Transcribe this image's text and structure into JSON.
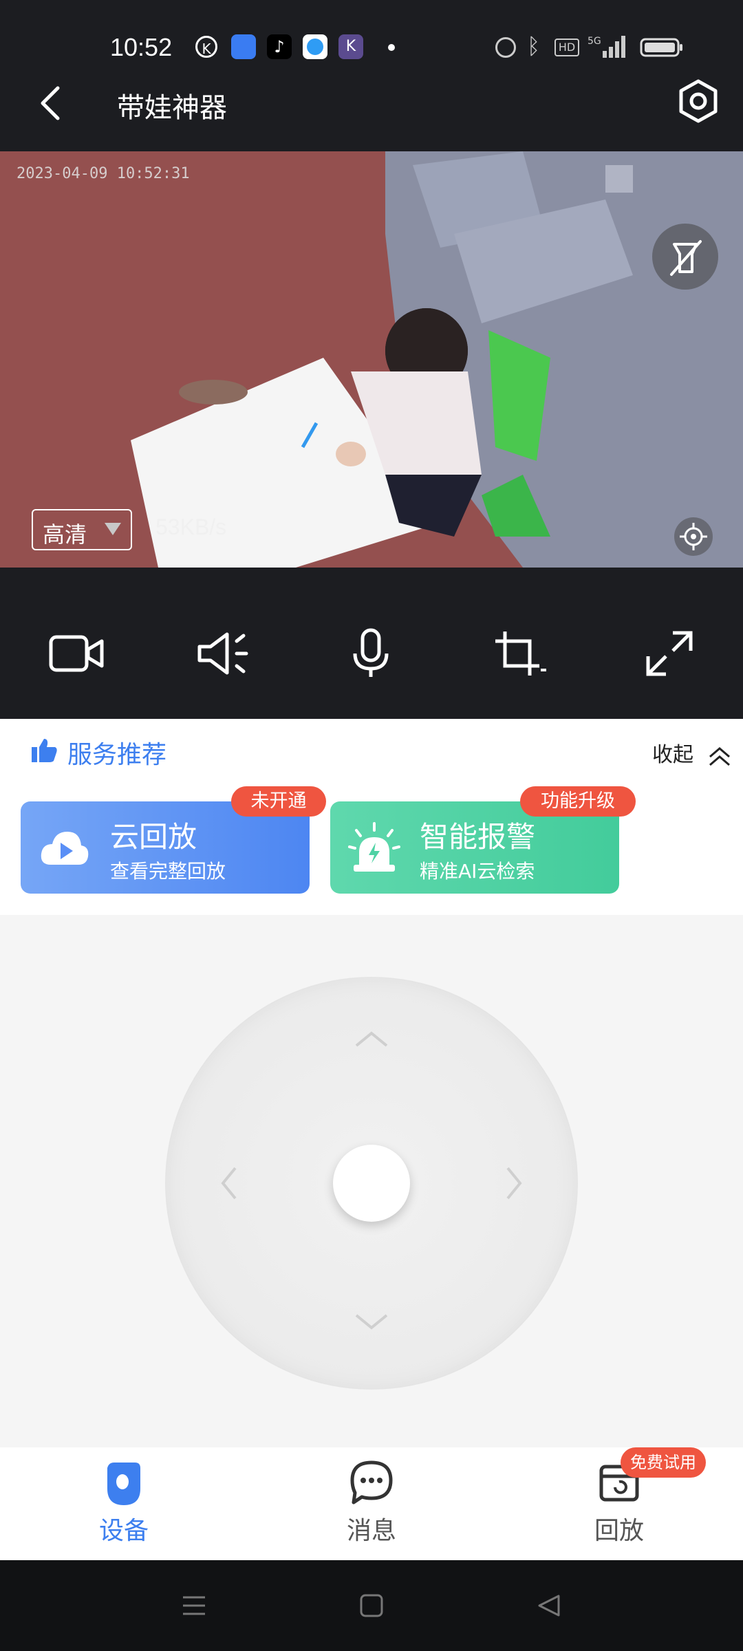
{
  "status_bar": {
    "time": "10:52",
    "app_icons": [
      "k-circle-icon",
      "blue-app-icon",
      "tiktok-icon",
      "browser-icon",
      "k-app-icon",
      "dot-icon"
    ],
    "right_icons": [
      "alarm-icon",
      "bluetooth-icon",
      "hd-icon",
      "5g-signal-icon",
      "battery-icon"
    ]
  },
  "header": {
    "title": "带娃神器",
    "back_icon": "chevron-left-icon",
    "settings_icon": "settings-hex-icon"
  },
  "video": {
    "osd_timestamp": "2023-04-09 10:52:31",
    "quality_label": "高清",
    "speed": "53KB/s",
    "overlay_icons": [
      "flashlight-off-icon",
      "crosshair-icon"
    ]
  },
  "controls": [
    "record-video-icon",
    "speaker-icon",
    "microphone-icon",
    "crop-icon",
    "fullscreen-icon"
  ],
  "service": {
    "title": "服务推荐",
    "collapse_label": "收起",
    "cards": [
      {
        "title": "云回放",
        "subtitle": "查看完整回放",
        "badge": "未开通",
        "icon": "cloud-play-icon",
        "color": "#5a8ff6"
      },
      {
        "title": "智能报警",
        "subtitle": "精准AI云检索",
        "badge": "功能升级",
        "icon": "alarm-light-icon",
        "color": "#4fd2a4"
      }
    ]
  },
  "ptz": {
    "directions": [
      "up-arrow-icon",
      "down-arrow-icon",
      "left-arrow-icon",
      "right-arrow-icon"
    ]
  },
  "bottom_nav": {
    "items": [
      {
        "label": "设备",
        "icon": "device-camera-icon",
        "active": true
      },
      {
        "label": "消息",
        "icon": "message-bubble-icon",
        "active": false
      },
      {
        "label": "回放",
        "icon": "playback-calendar-icon",
        "active": false,
        "badge": "免费试用"
      }
    ],
    "active_color": "#3d7fef",
    "inactive_color": "#555555"
  },
  "system_nav": [
    "menu-lines-icon",
    "home-square-icon",
    "back-triangle-icon"
  ]
}
